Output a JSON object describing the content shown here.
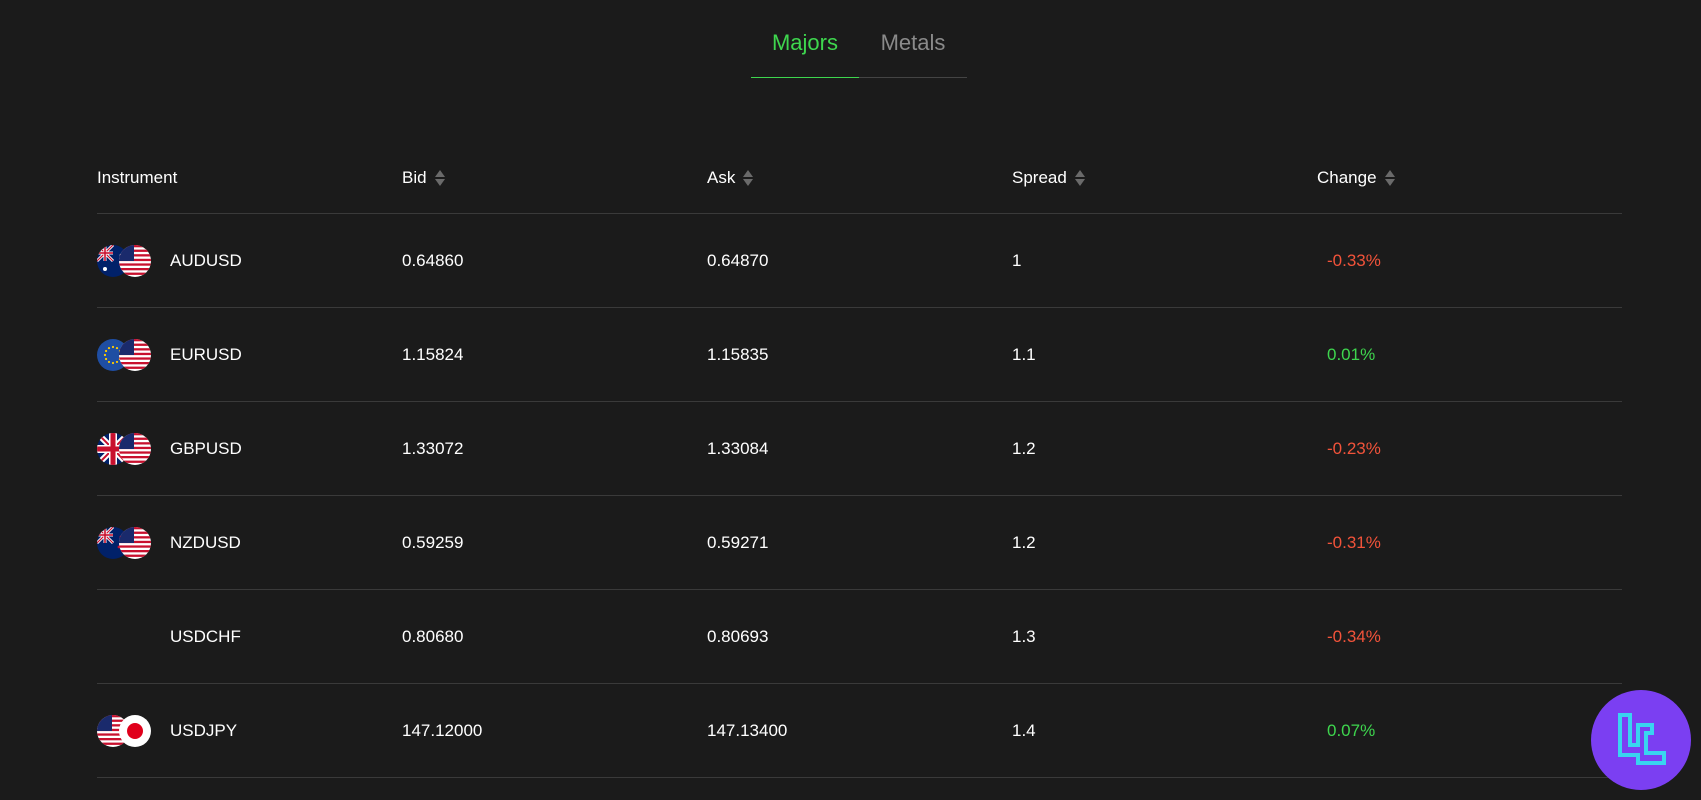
{
  "tabs": [
    {
      "label": "Majors",
      "active": true
    },
    {
      "label": "Metals",
      "active": false
    }
  ],
  "table": {
    "columns": [
      "Instrument",
      "Bid",
      "Ask",
      "Spread",
      "Change"
    ],
    "rows": [
      {
        "instrument": "AUDUSD",
        "flags": [
          "australia-flag-icon",
          "usa-flag-icon"
        ],
        "bid": "0.64860",
        "ask": "0.64870",
        "spread": "1",
        "change": "-0.33%",
        "direction": "negative"
      },
      {
        "instrument": "EURUSD",
        "flags": [
          "eu-flag-icon",
          "usa-flag-icon"
        ],
        "bid": "1.15824",
        "ask": "1.15835",
        "spread": "1.1",
        "change": "0.01%",
        "direction": "positive"
      },
      {
        "instrument": "GBPUSD",
        "flags": [
          "uk-flag-icon",
          "usa-flag-icon"
        ],
        "bid": "1.33072",
        "ask": "1.33084",
        "spread": "1.2",
        "change": "-0.23%",
        "direction": "negative"
      },
      {
        "instrument": "NZDUSD",
        "flags": [
          "new-zealand-flag-icon",
          "usa-flag-icon"
        ],
        "bid": "0.59259",
        "ask": "0.59271",
        "spread": "1.2",
        "change": "-0.31%",
        "direction": "negative"
      },
      {
        "instrument": "USDCHF",
        "flags": [],
        "bid": "0.80680",
        "ask": "0.80693",
        "spread": "1.3",
        "change": "-0.34%",
        "direction": "negative"
      },
      {
        "instrument": "USDJPY",
        "flags": [
          "usa-flag-icon",
          "japan-flag-icon"
        ],
        "bid": "147.12000",
        "ask": "147.13400",
        "spread": "1.4",
        "change": "0.07%",
        "direction": "positive"
      }
    ]
  },
  "colors": {
    "background": "#1b1b1b",
    "accent_green": "#3ed64e",
    "negative_red": "#f2533a",
    "badge_purple": "#7b3ff2",
    "badge_cyan": "#39d4f0"
  },
  "badge_icon": "tradingfinder-logo-icon"
}
